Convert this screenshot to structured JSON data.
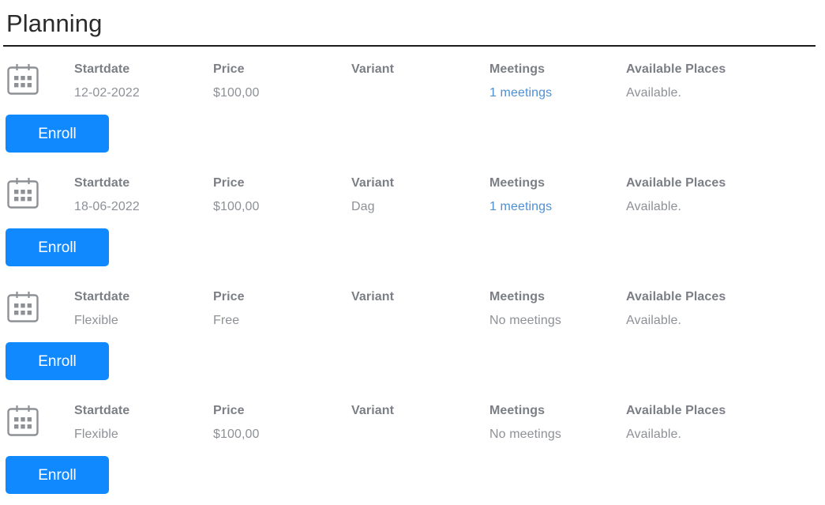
{
  "header": {
    "title": "Planning"
  },
  "colors": {
    "button_blue": "#1089ff",
    "link_blue": "#4f90d4",
    "label_gray": "#7b7f85",
    "value_gray": "#8d9196",
    "rule": "#1d1d1d"
  },
  "columns": {
    "startdate": "Startdate",
    "price": "Price",
    "variant": "Variant",
    "meetings": "Meetings",
    "places": "Available Places"
  },
  "actions": {
    "enroll": "Enroll"
  },
  "icons": {
    "calendar": "calendar-icon"
  },
  "rows": [
    {
      "startdate": "12-02-2022",
      "price": "$100,00",
      "variant": "",
      "meetings": "1 meetings",
      "meetings_is_link": true,
      "places": "Available.",
      "has_enroll": true
    },
    {
      "startdate": "18-06-2022",
      "price": "$100,00",
      "variant": "Dag",
      "meetings": "1 meetings",
      "meetings_is_link": true,
      "places": "Available.",
      "has_enroll": true
    },
    {
      "startdate": "Flexible",
      "price": "Free",
      "variant": "",
      "meetings": "No meetings",
      "meetings_is_link": false,
      "places": "Available.",
      "has_enroll": true
    },
    {
      "startdate": "Flexible",
      "price": "$100,00",
      "variant": "",
      "meetings": "No meetings",
      "meetings_is_link": false,
      "places": "Available.",
      "has_enroll": true
    }
  ]
}
